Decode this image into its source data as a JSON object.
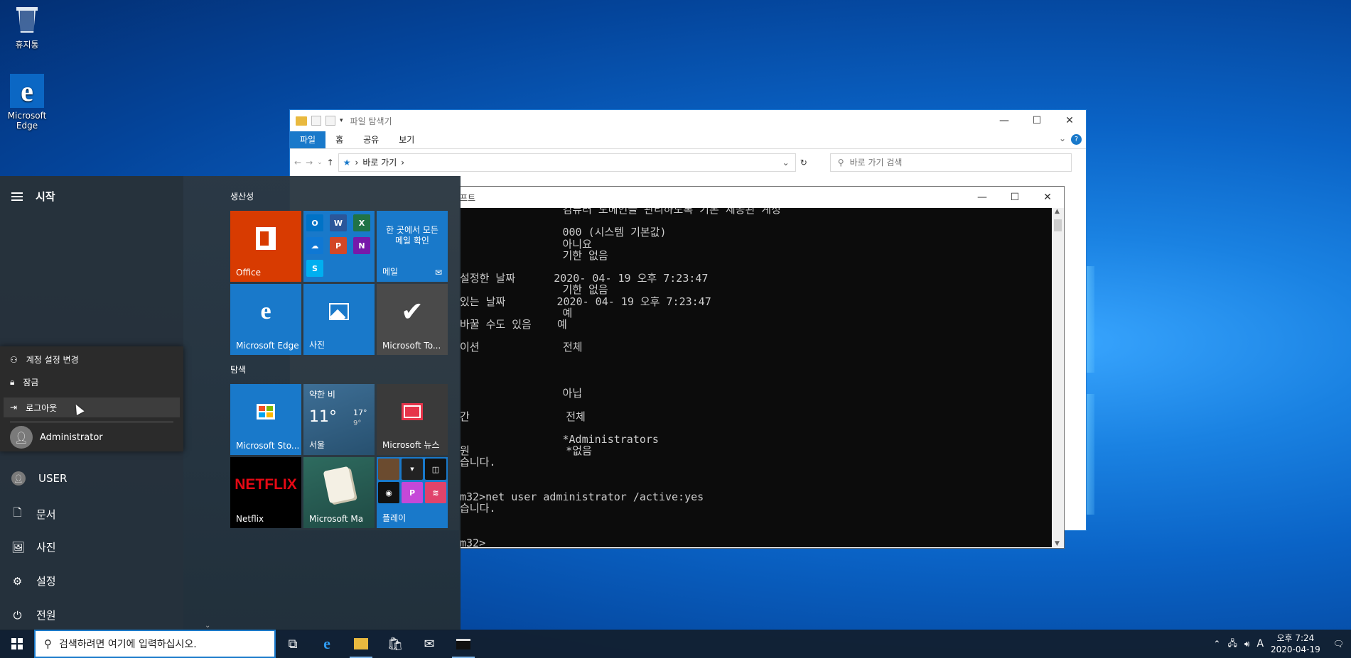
{
  "desktop": {
    "icons": [
      {
        "label": "휴지통",
        "icon": "recycle-bin-icon"
      },
      {
        "label_line1": "Microsoft",
        "label_line2": "Edge",
        "icon": "edge-icon"
      }
    ]
  },
  "explorer": {
    "title": "파일 탐색기",
    "ribbon_tabs": [
      "파일",
      "홈",
      "공유",
      "보기"
    ],
    "address_path": "바로 가기",
    "search_placeholder": "바로 가기 검색"
  },
  "cmd": {
    "title_fragment": "프트",
    "lines": [
      "                컴퓨터 도메인을 관리하도록 기본 제공된 계정",
      "",
      "                000 (시스템 기본값)",
      "                아니요",
      "                기한 없음",
      "",
      "설정한 날짜      2020- 04- 19 오후 7:23:47",
      "                기한 없음",
      "있는 날짜        2020- 04- 19 오후 7:23:47",
      "                예",
      "바꿀 수도 있음    예",
      "",
      "이션             전체",
      "",
      "",
      "",
      "                아닙",
      "",
      "간               전체",
      "",
      "                *Administrators",
      "원               *없음",
      "습니다.",
      "",
      "",
      "m32>net user administrator /active:yes",
      "습니다.",
      "",
      "",
      "m32>"
    ]
  },
  "start_menu": {
    "header": "시작",
    "account_popup": {
      "items": [
        "계정 설정 변경",
        "잠금",
        "로그아웃"
      ],
      "user": "Administrator"
    },
    "rail": [
      "USER",
      "문서",
      "사진",
      "설정",
      "전원"
    ],
    "groups": [
      "생산성",
      "탐색"
    ],
    "tiles": {
      "office": "Office",
      "mail_text": "한 곳에서 모든 메일 확인",
      "mail": "메일",
      "edge": "Microsoft Edge",
      "photos": "사진",
      "todo": "Microsoft To...",
      "store": "Microsoft Sto...",
      "weather_cond": "약한 비",
      "weather_temp": "11°",
      "weather_hi": "17°",
      "weather_lo": "9°",
      "weather_city": "서울",
      "news": "Microsoft 뉴스",
      "netflix_logo": "NETFLIX",
      "netflix": "Netflix",
      "mahjong": "Microsoft Ma",
      "play": "플레이"
    }
  },
  "taskbar": {
    "search_placeholder": "검색하려면 여기에 입력하십시오.",
    "ime": "A",
    "time": "오후 7:24",
    "date": "2020-04-19"
  }
}
